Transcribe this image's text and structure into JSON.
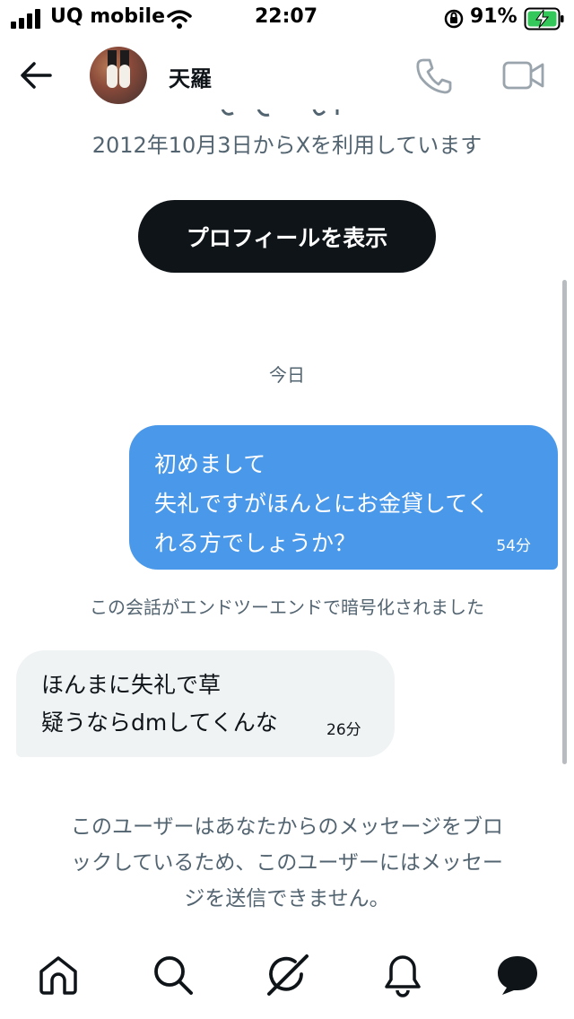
{
  "status_bar": {
    "carrier": "UQ mobile",
    "time": "22:07",
    "battery": "91%"
  },
  "header": {
    "back_icon": "arrow-left-icon",
    "name": "天羅",
    "call_icon": "phone-icon",
    "video_icon": "video-icon"
  },
  "profile_info": {
    "joined_text": "2012年10月3日からXを利用しています",
    "view_profile_label": "プロフィールを表示"
  },
  "conversation": {
    "date_separator": "今日",
    "messages": [
      {
        "direction": "outgoing",
        "lines": [
          "初めまして",
          "失礼ですがほんとにお金貸してく",
          "れる方でしょうか？"
        ],
        "time": "54分"
      },
      {
        "direction": "incoming",
        "lines": [
          "ほんまに失礼で草",
          "疑うならdmしてくんな"
        ],
        "time": "26分"
      }
    ],
    "encryption_notice": "この会話がエンドツーエンドで暗号化されました",
    "blocked_notice_lines": [
      "このユーザーはあなたからのメッセージをブロ",
      "ックしているため、このユーザーにはメッセー",
      "ジを送信できません。"
    ]
  },
  "bottom_nav": [
    "home-icon",
    "search-icon",
    "grok-icon",
    "bell-icon",
    "messages-icon"
  ],
  "colors": {
    "outgoing_bubble": "#4a98e9",
    "incoming_bubble": "#eff3f4",
    "button_bg": "#0f1419",
    "secondary_text": "#536471",
    "battery_green": "#34c759"
  }
}
